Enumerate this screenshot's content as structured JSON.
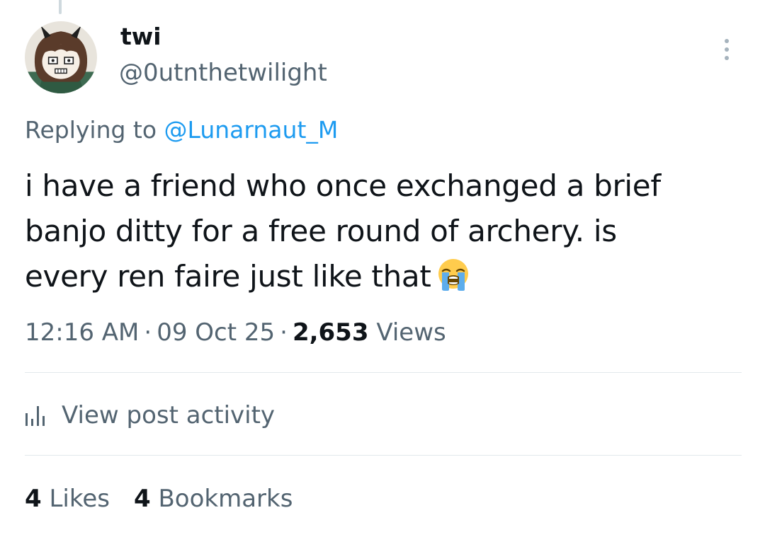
{
  "author": {
    "display_name": "twi",
    "handle": "@0utnthetwilight"
  },
  "reply": {
    "prefix": "Replying to",
    "mention": "@Lunarnaut_M"
  },
  "tweet": {
    "lines": [
      "i have a friend who once exchanged a brief",
      "banjo ditty for a free round of archery. is",
      "every ren faire just like that"
    ],
    "emoji": "loudly-crying-face"
  },
  "meta": {
    "time": "12:16 AM",
    "date": "09 Oct 25",
    "views_count": "2,653",
    "views_label": "Views"
  },
  "activity": {
    "label": "View post activity",
    "icon": "bar-chart-icon"
  },
  "stats": {
    "likes_count": "4",
    "likes_label": "Likes",
    "bookmarks_count": "4",
    "bookmarks_label": "Bookmarks"
  },
  "colors": {
    "link": "#1d9bf0",
    "secondary_text": "#536471",
    "primary_text": "#0f1419",
    "divider": "#e2e8ec"
  }
}
